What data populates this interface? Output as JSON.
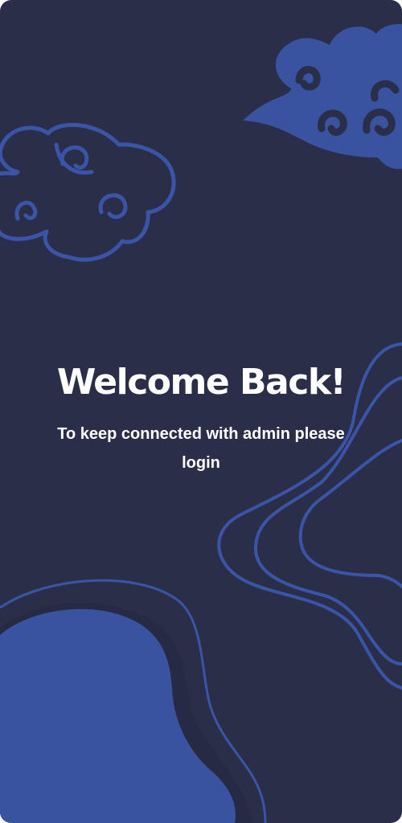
{
  "welcome": {
    "title": "Welcome Back!",
    "subtitle": "To keep connected with admin please login"
  },
  "theme": {
    "background": "#2a2e48",
    "accent": "#3953a0",
    "line": "#3a55a8"
  }
}
